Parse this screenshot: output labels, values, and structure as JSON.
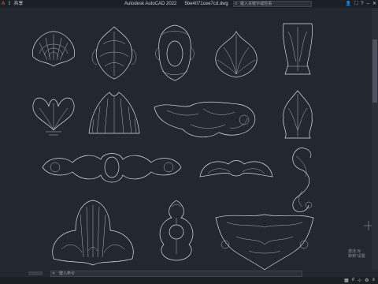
{
  "window": {
    "app_title": "Autodesk AutoCAD 2022",
    "file_name": "5be4071cee7cd.dwg",
    "share_label": "共享",
    "search_placeholder": "键入关键字或短语"
  },
  "command_line": {
    "placeholder": "键入命令"
  },
  "activation_notice": {
    "line1": "激活 W",
    "line2": "转到\"设置"
  },
  "colors": {
    "canvas_bg": "#212830",
    "linework": "#d9dde2",
    "chrome": "#1b2026"
  },
  "icons": [
    "app-menu-icon",
    "share-icon",
    "search-icon",
    "user-icon",
    "cart-icon",
    "help-icon",
    "minimize-icon",
    "close-icon",
    "command-close-icon",
    "crosshair-icon"
  ]
}
